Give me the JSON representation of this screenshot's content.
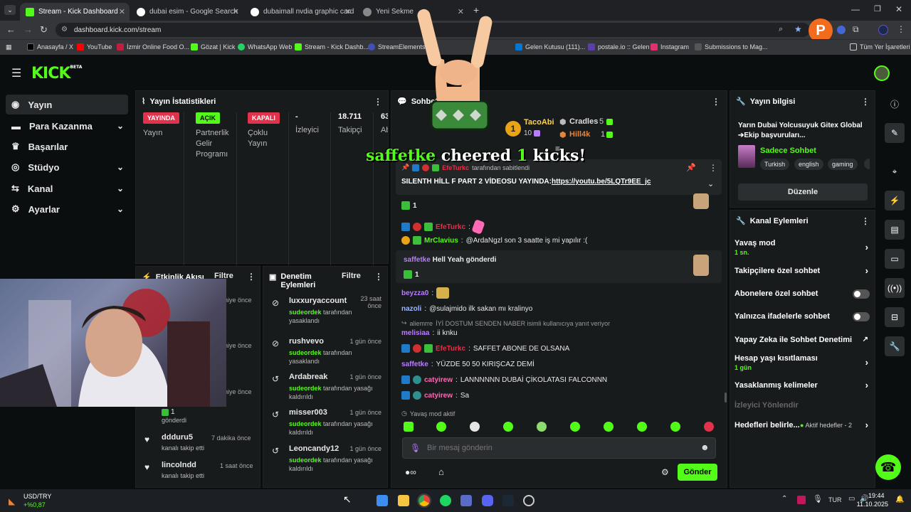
{
  "browser": {
    "tabs": [
      {
        "label": "Stream - Kick Dashboard",
        "active": true
      },
      {
        "label": "dubai esim - Google Search",
        "active": false
      },
      {
        "label": "dubaimall nvdia graphic card -",
        "active": false
      },
      {
        "label": "Yeni Sekme",
        "active": false
      }
    ],
    "url": "dashboard.kick.com/stream",
    "profile_initial": "P",
    "bookmarks": [
      "Anasayfa / X",
      "YouTube",
      "İzmir Online Food O...",
      "Gözat | Kick",
      "WhatsApp Web",
      "Stream - Kick Dashb...",
      "StreamElements",
      "Gelen Kutusu (111)...",
      "postale.io :: Gelen",
      "Instagram",
      "Submissions to Mag...",
      "Tüm Yer İşaretleri"
    ]
  },
  "kick": {
    "logo": "KICK",
    "logo_tag": "BETA",
    "nav": [
      {
        "label": "Yayın",
        "active": true,
        "chevron": false
      },
      {
        "label": "Para Kazanma",
        "active": false,
        "chevron": true
      },
      {
        "label": "Başarılar",
        "active": false,
        "chevron": false
      },
      {
        "label": "Stüdyo",
        "active": false,
        "chevron": true
      },
      {
        "label": "Kanal",
        "active": false,
        "chevron": true
      },
      {
        "label": "Ayarlar",
        "active": false,
        "chevron": true
      }
    ]
  },
  "stats": {
    "title": "Yayın İstatistikleri",
    "cols": [
      {
        "badge": "YAYINDA",
        "badge_color": "#e0324b",
        "label": "Yayın"
      },
      {
        "badge": "AÇIK",
        "badge_color": "#53fc18",
        "label": "Partnerlik Gelir Programı"
      },
      {
        "badge": "KAPALI",
        "badge_color": "#e0324b",
        "label": "Çoklu Yayın"
      },
      {
        "value": "-",
        "label": "İzleyici"
      },
      {
        "value": "18.711",
        "label": "Takipçi"
      },
      {
        "value": "63",
        "label": "Ab"
      }
    ]
  },
  "activity": {
    "title": "Etkinlik Akışı",
    "filter": "Filtre",
    "times": [
      "niye önce",
      "niye önce",
      "niye önce"
    ],
    "partial": {
      "count": "1",
      "text": "gönderdi"
    },
    "items": [
      {
        "user": "ddduru5",
        "text": "kanalı takip etti",
        "time": "7 dakika önce"
      },
      {
        "user": "lincolndd",
        "text": "kanalı takip etti",
        "time": "1 saat önce"
      }
    ]
  },
  "moderation": {
    "title": "Denetim Eylemleri",
    "filter": "Filtre",
    "items": [
      {
        "user": "luxxuryaccount",
        "time": "23 saat önce",
        "mod": "sudeordek",
        "action": "tarafından yasaklandı",
        "icon": "ban-icon"
      },
      {
        "user": "rushvevo",
        "time": "1 gün önce",
        "mod": "sudeordek",
        "action": "tarafından yasaklandı",
        "icon": "ban-icon"
      },
      {
        "user": "Ardabreak",
        "time": "1 gün önce",
        "mod": "sudeordek",
        "action": "tarafından yasağı kaldırıldı",
        "icon": "undo-icon"
      },
      {
        "user": "misser003",
        "time": "1 gün önce",
        "mod": "sudeordek",
        "action": "tarafından yasağı kaldırıldı",
        "icon": "undo-icon"
      },
      {
        "user": "Leoncandy12",
        "time": "1 gün önce",
        "mod": "sudeordek",
        "action": "tarafından yasağı kaldırıldı",
        "icon": "undo-icon"
      }
    ]
  },
  "chat": {
    "title": "Sohbet",
    "leaders": [
      {
        "name": "TacoAbi",
        "count": "10"
      },
      {
        "name": "Cradles",
        "count": "5"
      },
      {
        "name": "Hill4k",
        "count": "1"
      }
    ],
    "overlay": {
      "user": "saffetke",
      "text1": "cheered",
      "num": "1",
      "text2": "kicks!"
    },
    "pinned": {
      "by": "EfeTurkc",
      "by_text": "tarafından sabitlendi",
      "message": "SILENTH HİLL F PART 2 VİDEOSU YAYINDA:",
      "link": "https://youtu.be/5LQTr9EE_jc"
    },
    "kick_count": "1",
    "messages": [
      {
        "user": "EfeTurkc",
        "text": "",
        "color": "red"
      },
      {
        "user": "MrClavius",
        "text": "@ArdaNgzl son 3 saatte iş mi yapılır :(",
        "color": "green"
      },
      {
        "user": "saffetke",
        "text": "Hell Yeah gönderdi",
        "color": "purple"
      },
      {
        "user": "beyzza0",
        "text": "",
        "color": "purple"
      },
      {
        "user": "nazoli",
        "text": "@sulajmido ilk sakan mı kralinyo",
        "color": "blue"
      },
      {
        "user": "aliemrre",
        "text": "İYİ DOSTUM SENDEN NABER isimli kullanıcıya yanıt veriyor",
        "color": "reply"
      },
      {
        "user": "melisiaa",
        "text": "ii knku",
        "color": "purple"
      },
      {
        "user": "EfeTurkc",
        "text": "SAFFET ABONE DE OLSANA",
        "color": "red"
      },
      {
        "user": "saffetke",
        "text": "YÜZDE 50 50 KIRIŞCAZ DEMİ",
        "color": "purple"
      },
      {
        "user": "catyirew",
        "text": "LANNNNNN DUBAİ ÇİKOLATASI FALCONNN",
        "color": "pink"
      },
      {
        "user": "catyirew",
        "text": "Sa",
        "color": "pink"
      }
    ],
    "slow_mode": "Yavaş mod aktif",
    "placeholder": "Bir mesaj gönderin",
    "send": "Gönder"
  },
  "info": {
    "title": "Yayın bilgisi",
    "stream_title": "Yarın Dubai Yolcusuyuk Gitex Global ➔Ekip başvuruları...",
    "category": "Sadece Sohbet",
    "tags": [
      "Turkish",
      "english",
      "gaming"
    ],
    "edit": "Düzenle"
  },
  "actions": {
    "title": "Kanal Eylemleri",
    "slow": {
      "label": "Yavaş mod",
      "sub": "1 sn."
    },
    "followers": "Takipçilere özel sohbet",
    "subs": "Abonelere özel sohbet",
    "emotes": "Yalnızca ifadelerle sohbet",
    "ai": "Yapay Zeka ile Sohbet Denetimi",
    "age": {
      "label": "Hesap yaşı kısıtlaması",
      "sub": "1 gün"
    },
    "banned": "Yasaklanmış kelimeler",
    "redirect": "İzleyici Yönlendir",
    "goals": {
      "label": "Hedefleri belirle...",
      "sub": "Aktif hedefler - 2"
    }
  },
  "taskbar": {
    "ticker": "USD/TRY",
    "change": "+%0,87",
    "lang": "TUR",
    "time": "19:44",
    "date": "11.10.2025"
  },
  "colors": {
    "accent": "#53fc18",
    "panel": "#181b1c",
    "bg": "#0b0e0f"
  }
}
